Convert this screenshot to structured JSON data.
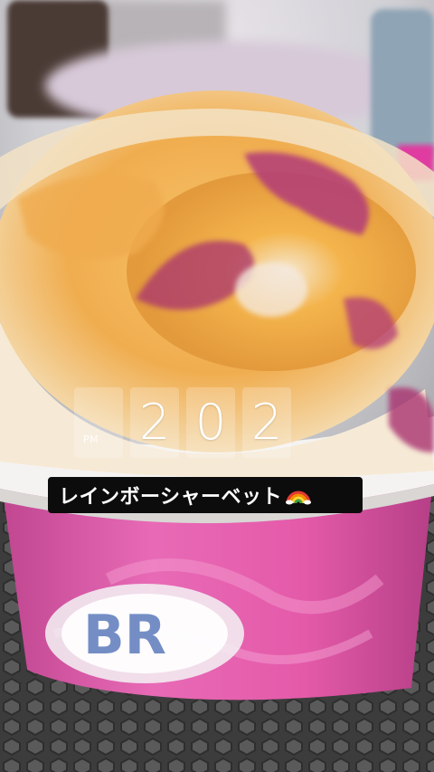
{
  "story": {
    "time_sticker": {
      "ampm": "PM",
      "digits": [
        "2",
        "0",
        "2"
      ]
    },
    "caption": {
      "text": "レインボーシャーベット",
      "emoji_icon": "rainbow-emoji-icon"
    },
    "photo": {
      "logo_text": "BR"
    }
  },
  "colors": {
    "cup_pink": "#e05aa8",
    "sherbet_orange": "#f0b04a",
    "sherbet_purple": "#a8326e",
    "mat_gray": "#4a4a4a",
    "caption_bg": "#0c0c0c"
  }
}
